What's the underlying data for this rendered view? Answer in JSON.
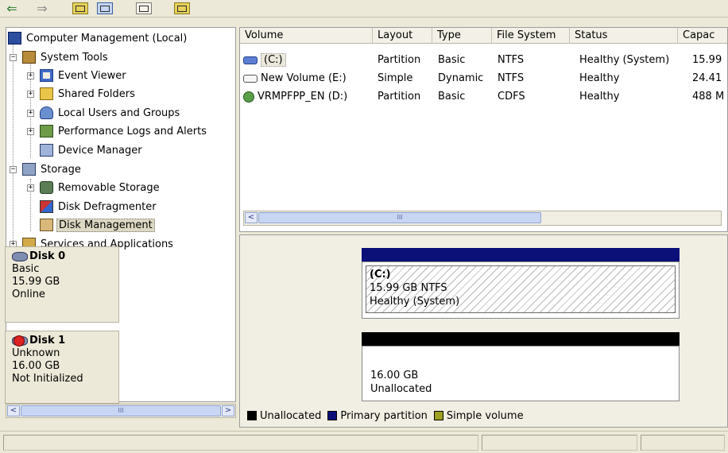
{
  "toolbar": {
    "icons": [
      "back-arrow-icon",
      "forward-arrow-icon",
      "show-hide-tree-icon",
      "properties-icon",
      "export-list-icon",
      "help-icon"
    ]
  },
  "tree": {
    "root": "Computer Management (Local)",
    "system_tools": "System Tools",
    "event_viewer": "Event Viewer",
    "shared_folders": "Shared Folders",
    "local_users": "Local Users and Groups",
    "perf_logs": "Performance Logs and Alerts",
    "device_manager": "Device Manager",
    "storage": "Storage",
    "removable_storage": "Removable Storage",
    "disk_defrag": "Disk Defragmenter",
    "disk_management": "Disk Management",
    "services": "Services and Applications",
    "expanders": {
      "minus": "−",
      "plus": "+"
    }
  },
  "volumes": {
    "columns": [
      "Volume",
      "Layout",
      "Type",
      "File System",
      "Status",
      "Capac"
    ],
    "rows": [
      {
        "volume": "(C:)",
        "layout": "Partition",
        "type": "Basic",
        "fs": "NTFS",
        "status": "Healthy (System)",
        "capacity": "15.99"
      },
      {
        "volume": "New Volume (E:)",
        "layout": "Simple",
        "type": "Dynamic",
        "fs": "NTFS",
        "status": "Healthy",
        "capacity": "24.41"
      },
      {
        "volume": "VRMPFPP_EN (D:)",
        "layout": "Partition",
        "type": "Basic",
        "fs": "CDFS",
        "status": "Healthy",
        "capacity": "488 M"
      }
    ]
  },
  "scroll": {
    "left_arrow": "<",
    "right_arrow": ">",
    "thumb_grip": "III"
  },
  "disks": [
    {
      "name": "Disk 0",
      "kind": "Basic",
      "size": "15.99 GB",
      "state": "Online",
      "bar_color": "#0a1078",
      "partition": {
        "label": "(C:)",
        "detail": "15.99 GB NTFS",
        "status": "Healthy (System)"
      }
    },
    {
      "name": "Disk 1",
      "kind": "Unknown",
      "size": "16.00 GB",
      "state": "Not Initialized",
      "bar_color": "#000000",
      "partition": {
        "detail": "16.00 GB",
        "status": "Unallocated"
      }
    }
  ],
  "legend": [
    {
      "label": "Unallocated",
      "color": "#000000"
    },
    {
      "label": "Primary partition",
      "color": "#0a1078"
    },
    {
      "label": "Simple volume",
      "color": "#a0a020"
    }
  ]
}
